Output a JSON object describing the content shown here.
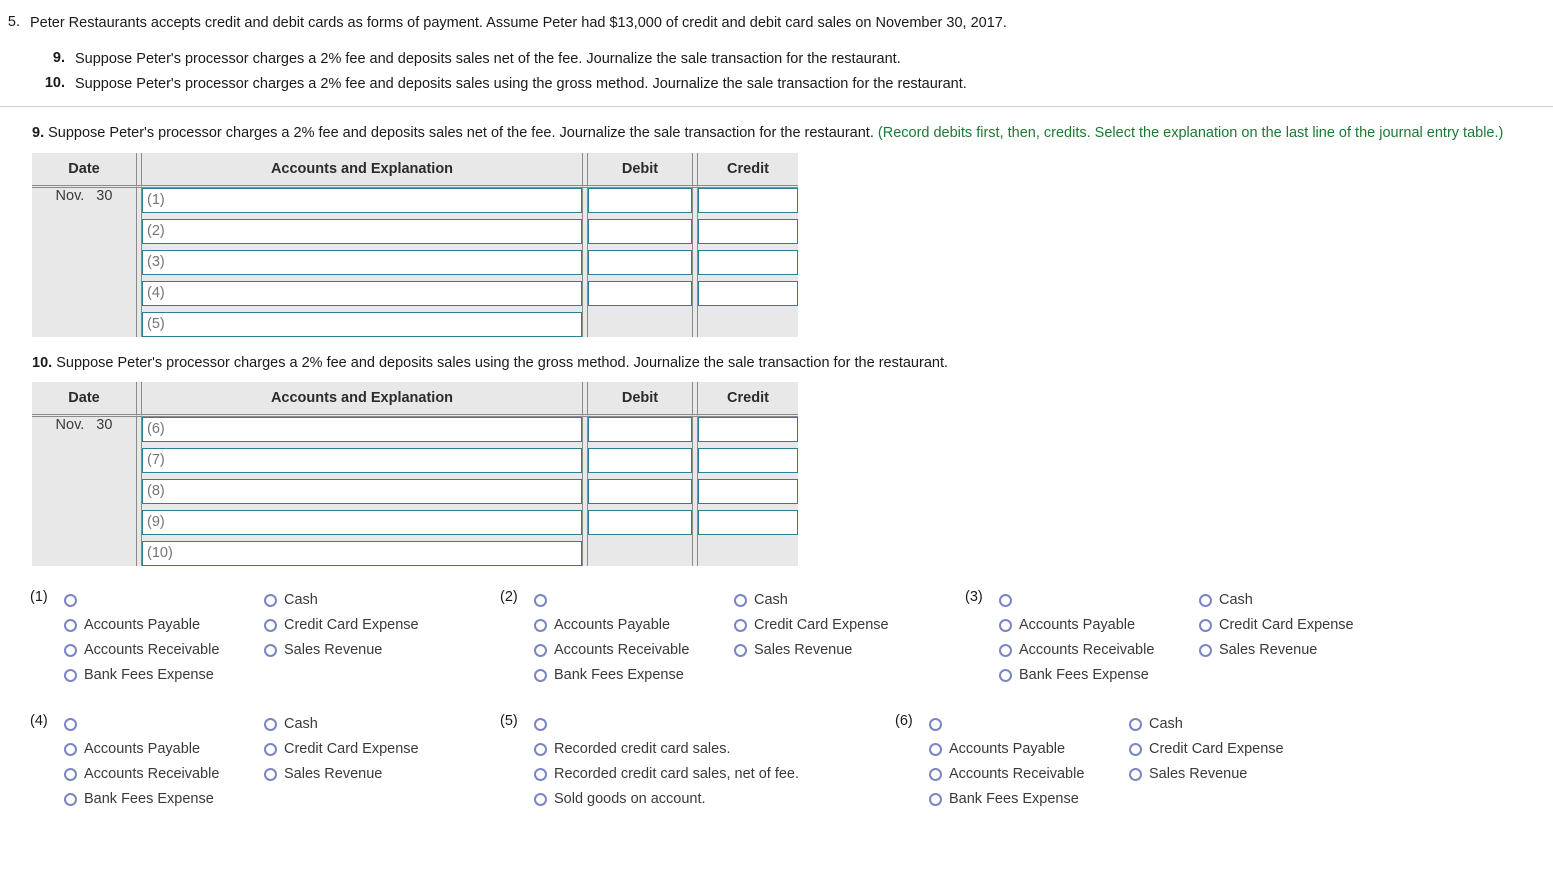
{
  "problem": {
    "number": "5.",
    "statement": "Peter Restaurants accepts credit and debit cards as forms of payment. Assume Peter had $13,000 of credit and debit card sales on November 30, 2017.",
    "sub_items": [
      {
        "number": "9.",
        "text": "Suppose Peter's processor charges a 2% fee and deposits sales net of the fee. Journalize the sale transaction for the restaurant."
      },
      {
        "number": "10.",
        "text": "Suppose Peter's processor charges a 2% fee and deposits sales using the gross method. Journalize the sale transaction for the restaurant."
      }
    ]
  },
  "requirements": [
    {
      "number": "9.",
      "text": "Suppose Peter's processor charges a 2% fee and deposits sales net of the fee. Journalize the sale transaction for the restaurant.",
      "hint": "(Record debits first, then, credits. Select the explanation on the last line of the journal entry table.)",
      "table": {
        "headers": [
          "Date",
          "Accounts and Explanation",
          "Debit",
          "Credit"
        ],
        "date_month": "Nov.",
        "date_day": "30",
        "rows": [
          {
            "account_placeholder": "(1)",
            "debit": "",
            "credit": "",
            "has_amounts": true
          },
          {
            "account_placeholder": "(2)",
            "debit": "",
            "credit": "",
            "has_amounts": true
          },
          {
            "account_placeholder": "(3)",
            "debit": "",
            "credit": "",
            "has_amounts": true
          },
          {
            "account_placeholder": "(4)",
            "debit": "",
            "credit": "",
            "has_amounts": true
          },
          {
            "account_placeholder": "(5)",
            "debit": "",
            "credit": "",
            "has_amounts": false
          }
        ]
      }
    },
    {
      "number": "10.",
      "text": "Suppose Peter's processor charges a 2% fee and deposits sales using the gross method. Journalize the sale transaction for the restaurant.",
      "hint": "",
      "table": {
        "headers": [
          "Date",
          "Accounts and Explanation",
          "Debit",
          "Credit"
        ],
        "date_month": "Nov.",
        "date_day": "30",
        "rows": [
          {
            "account_placeholder": "(6)",
            "debit": "",
            "credit": "",
            "has_amounts": true
          },
          {
            "account_placeholder": "(7)",
            "debit": "",
            "credit": "",
            "has_amounts": true
          },
          {
            "account_placeholder": "(8)",
            "debit": "",
            "credit": "",
            "has_amounts": true
          },
          {
            "account_placeholder": "(9)",
            "debit": "",
            "credit": "",
            "has_amounts": true
          },
          {
            "account_placeholder": "(10)",
            "debit": "",
            "credit": "",
            "has_amounts": false
          }
        ]
      }
    }
  ],
  "option_groups": [
    {
      "label": "(1)",
      "columns": [
        [
          "",
          "Accounts Payable",
          "Accounts Receivable",
          "Bank Fees Expense"
        ],
        [
          "Cash",
          "Credit Card Expense",
          "Sales Revenue"
        ]
      ]
    },
    {
      "label": "(2)",
      "columns": [
        [
          "",
          "Accounts Payable",
          "Accounts Receivable",
          "Bank Fees Expense"
        ],
        [
          "Cash",
          "Credit Card Expense",
          "Sales Revenue"
        ]
      ]
    },
    {
      "label": "(3)",
      "columns": [
        [
          "",
          "Accounts Payable",
          "Accounts Receivable",
          "Bank Fees Expense"
        ],
        [
          "Cash",
          "Credit Card Expense",
          "Sales Revenue"
        ]
      ]
    },
    {
      "label": "(4)",
      "columns": [
        [
          "",
          "Accounts Payable",
          "Accounts Receivable",
          "Bank Fees Expense"
        ],
        [
          "Cash",
          "Credit Card Expense",
          "Sales Revenue"
        ]
      ]
    },
    {
      "label": "(5)",
      "columns": [
        [
          "",
          "Recorded credit card sales.",
          "Recorded credit card sales, net of fee.",
          "Sold goods on account."
        ]
      ]
    },
    {
      "label": "(6)",
      "columns": [
        [
          "",
          "Accounts Payable",
          "Accounts Receivable",
          "Bank Fees Expense"
        ],
        [
          "Cash",
          "Credit Card Expense",
          "Sales Revenue"
        ]
      ]
    }
  ],
  "colors": {
    "hint_green": "#1a7a32",
    "table_bg": "#e8e8e8",
    "input_border": "#2d7f93",
    "radio_border": "#7a85c4"
  }
}
